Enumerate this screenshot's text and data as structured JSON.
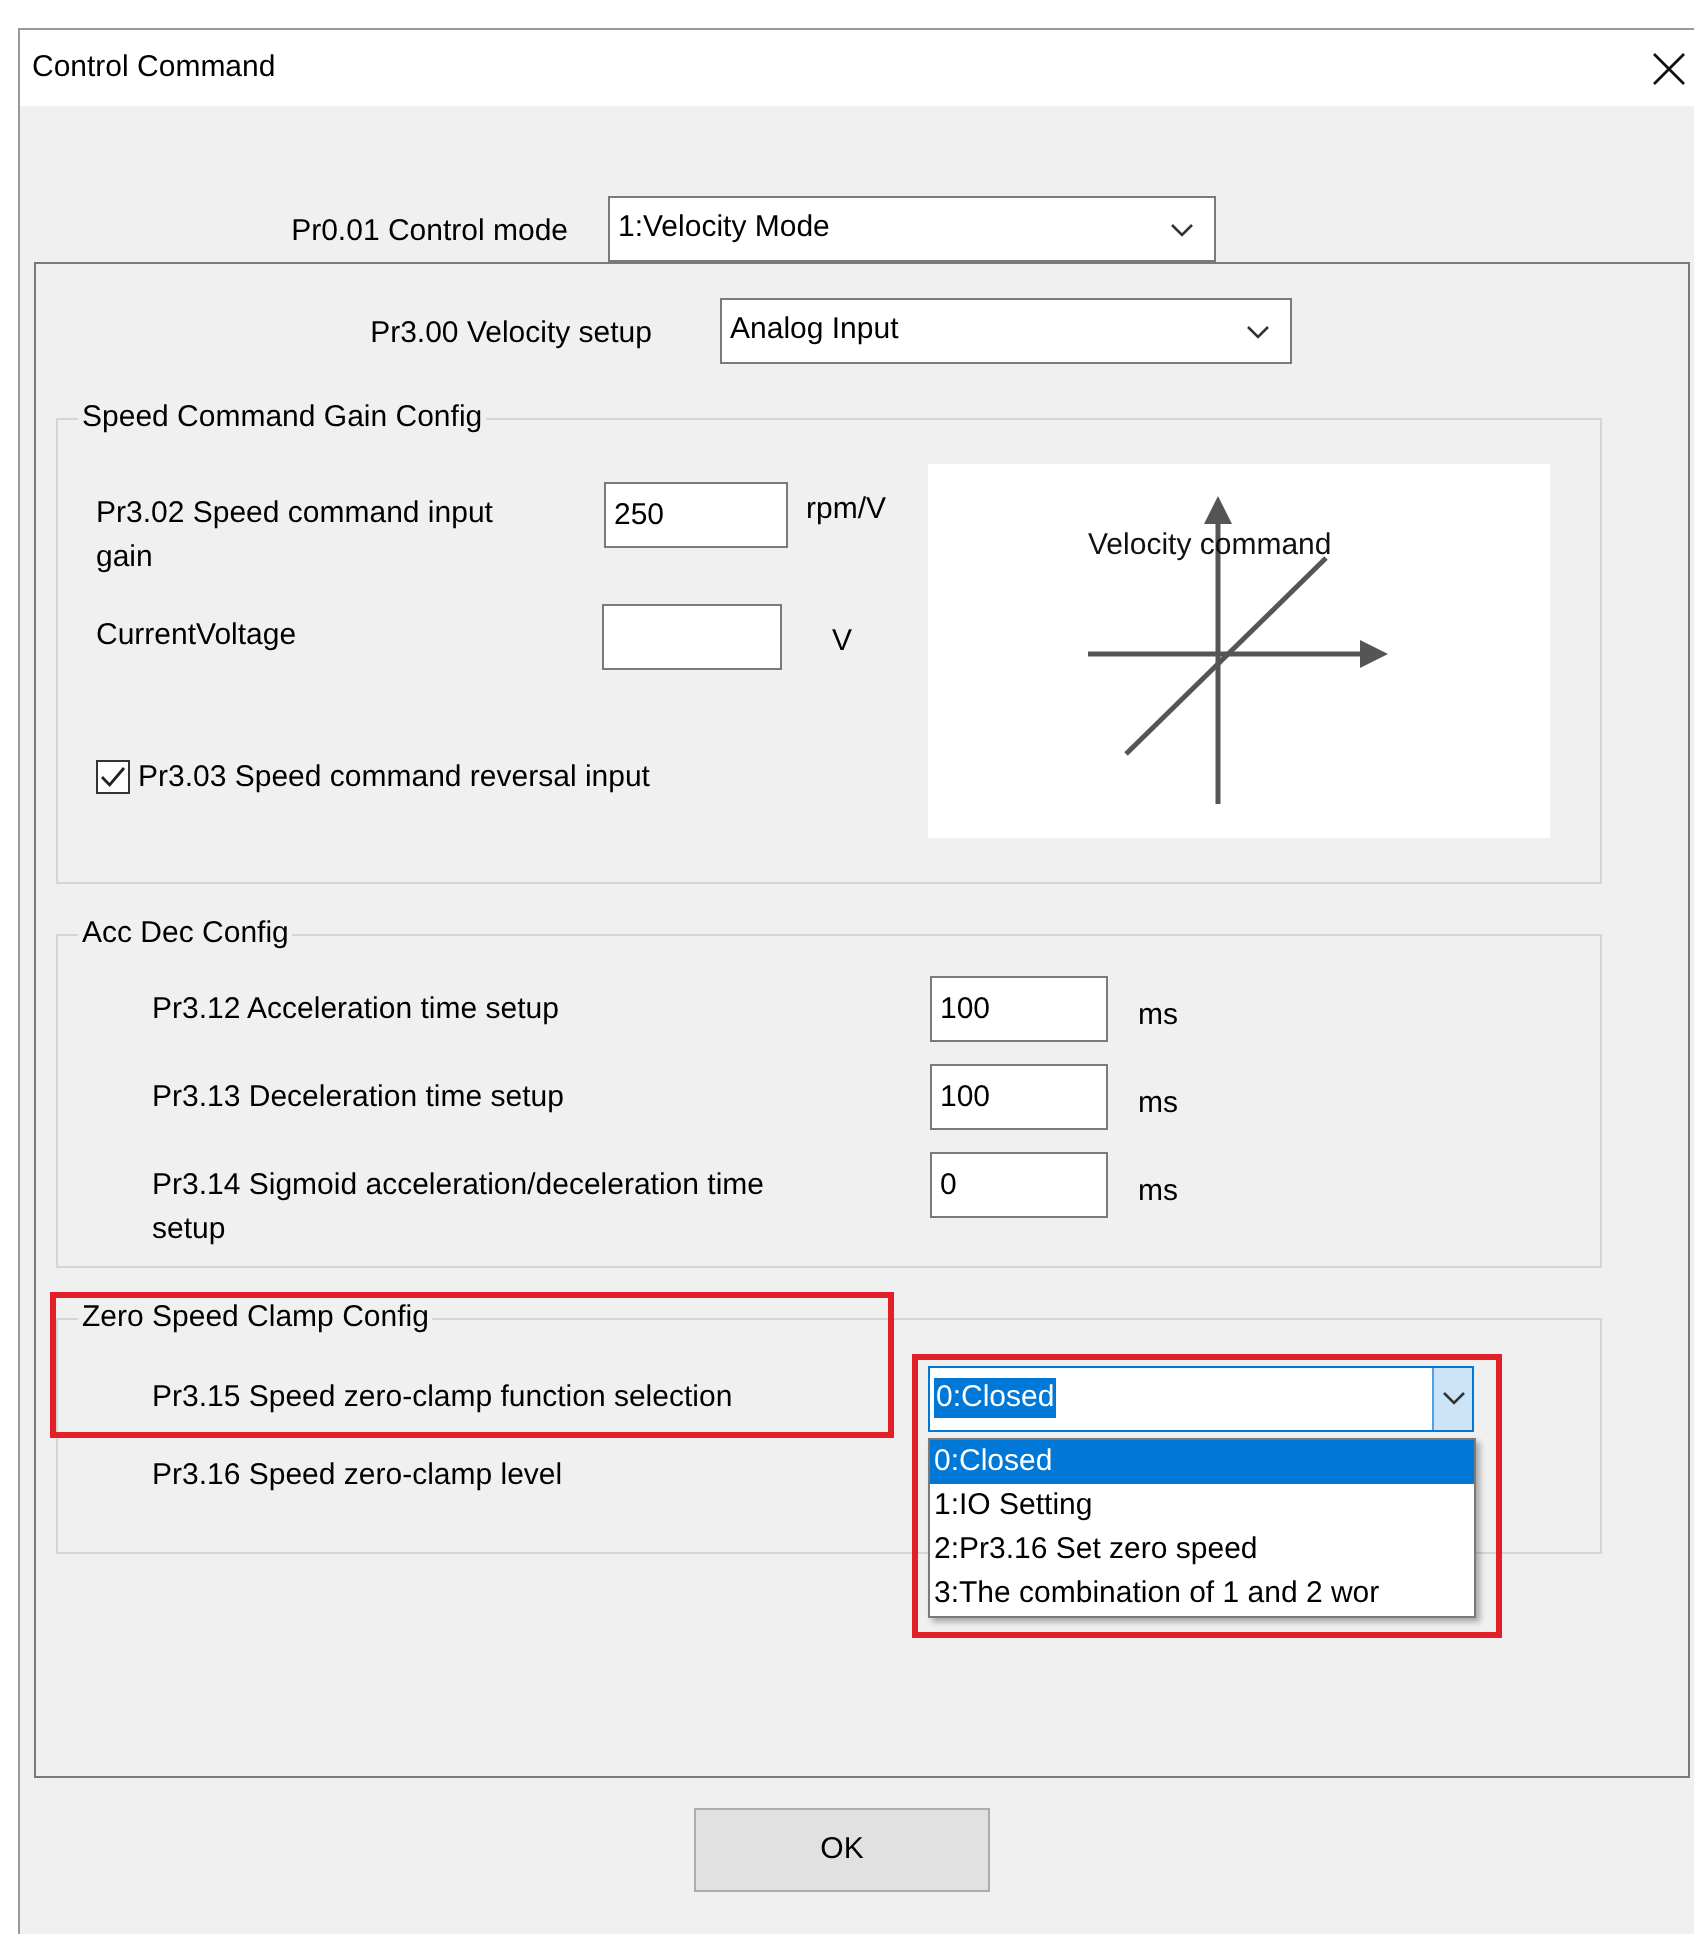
{
  "window": {
    "title": "Control Command"
  },
  "control_mode": {
    "label": "Pr0.01 Control mode",
    "value": "1:Velocity Mode"
  },
  "velocity_setup": {
    "label": "Pr3.00 Velocity setup",
    "value": "Analog Input"
  },
  "gain_group": {
    "title": "Speed Command Gain Config",
    "gain": {
      "label": "Pr3.02 Speed command input gain",
      "value": "250",
      "unit": "rpm/V"
    },
    "voltage": {
      "label": "CurrentVoltage",
      "unit": "V"
    },
    "reversal": {
      "label": "Pr3.03 Speed command reversal input",
      "checked": true
    },
    "diagram": {
      "label": "Velocity command"
    }
  },
  "acc_dec_group": {
    "title": "Acc Dec Config",
    "rows": [
      {
        "label": "Pr3.12 Acceleration time setup",
        "value": "100",
        "unit": "ms"
      },
      {
        "label": "Pr3.13 Deceleration time setup",
        "value": "100",
        "unit": "ms"
      },
      {
        "label": "Pr3.14 Sigmoid acceleration/deceleration time setup",
        "value": "0",
        "unit": "ms"
      }
    ]
  },
  "zero_clamp_group": {
    "title": "Zero Speed Clamp Config",
    "function": {
      "label": "Pr3.15 Speed zero-clamp function selection",
      "value": "0:Closed",
      "expanded": true,
      "options": [
        {
          "label": "0:Closed",
          "selected": true
        },
        {
          "label": "1:IO Setting",
          "selected": false
        },
        {
          "label": "2:Pr3.16 Set zero speed",
          "selected": false
        },
        {
          "label": "3:The combination of 1 and 2 wor",
          "selected": false
        }
      ]
    },
    "level": {
      "label": "Pr3.16 Speed zero-clamp level"
    }
  },
  "buttons": [
    "OK"
  ]
}
